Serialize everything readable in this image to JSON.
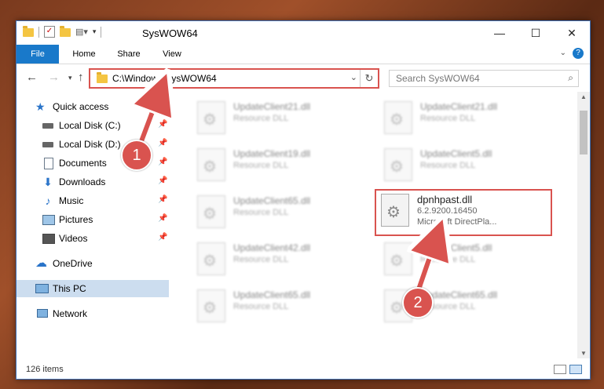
{
  "window": {
    "title": "SysWOW64"
  },
  "ribbon": {
    "tabs": [
      "File",
      "Home",
      "Share",
      "View"
    ]
  },
  "address": {
    "path": "C:\\Windows\\SysWOW64"
  },
  "search": {
    "placeholder": "Search SysWOW64"
  },
  "sidebar": {
    "items": [
      {
        "label": "Quick access",
        "icon": "star-icon"
      },
      {
        "label": "Local Disk (C:)",
        "icon": "drive-icon",
        "pinned": true
      },
      {
        "label": "Local Disk (D:)",
        "icon": "drive-icon",
        "pinned": true
      },
      {
        "label": "Documents",
        "icon": "document-icon",
        "pinned": true
      },
      {
        "label": "Downloads",
        "icon": "download-icon",
        "pinned": true
      },
      {
        "label": "Music",
        "icon": "music-icon",
        "pinned": true
      },
      {
        "label": "Pictures",
        "icon": "pictures-icon",
        "pinned": true
      },
      {
        "label": "Videos",
        "icon": "videos-icon",
        "pinned": true
      },
      {
        "label": "OneDrive",
        "icon": "cloud-icon"
      },
      {
        "label": "This PC",
        "icon": "computer-icon",
        "selected": true
      },
      {
        "label": "Network",
        "icon": "network-icon"
      }
    ]
  },
  "files": [
    {
      "name": "UpdateClient21.dll",
      "type": "Resource DLL"
    },
    {
      "name": "UpdateClient21.dll",
      "type": "Resource DLL"
    },
    {
      "name": "UpdateClient19.dll",
      "type": "Resource DLL"
    },
    {
      "name": "UpdateClient5.dll",
      "type": "Resource DLL"
    },
    {
      "name": "UpdateClient65.dll",
      "type": "Resource DLL"
    },
    {
      "name": "dpnhpast.dll",
      "version": "6.2.9200.16450",
      "description": "Microsoft DirectPla..."
    },
    {
      "name": "UpdateClient42.dll",
      "type": "Resource DLL"
    },
    {
      "name": "UpdateClient5.dll",
      "type": "Resource DLL"
    },
    {
      "name": "UpdateClient65.dll",
      "type": "Resource DLL"
    },
    {
      "name": "UpdateClient65.dll",
      "type": "Resource DLL"
    }
  ],
  "status": {
    "count": "126 items"
  },
  "annotations": {
    "step1": "1",
    "step2": "2"
  },
  "colors": {
    "accent": "#1979ca",
    "highlight": "#d9534f"
  }
}
